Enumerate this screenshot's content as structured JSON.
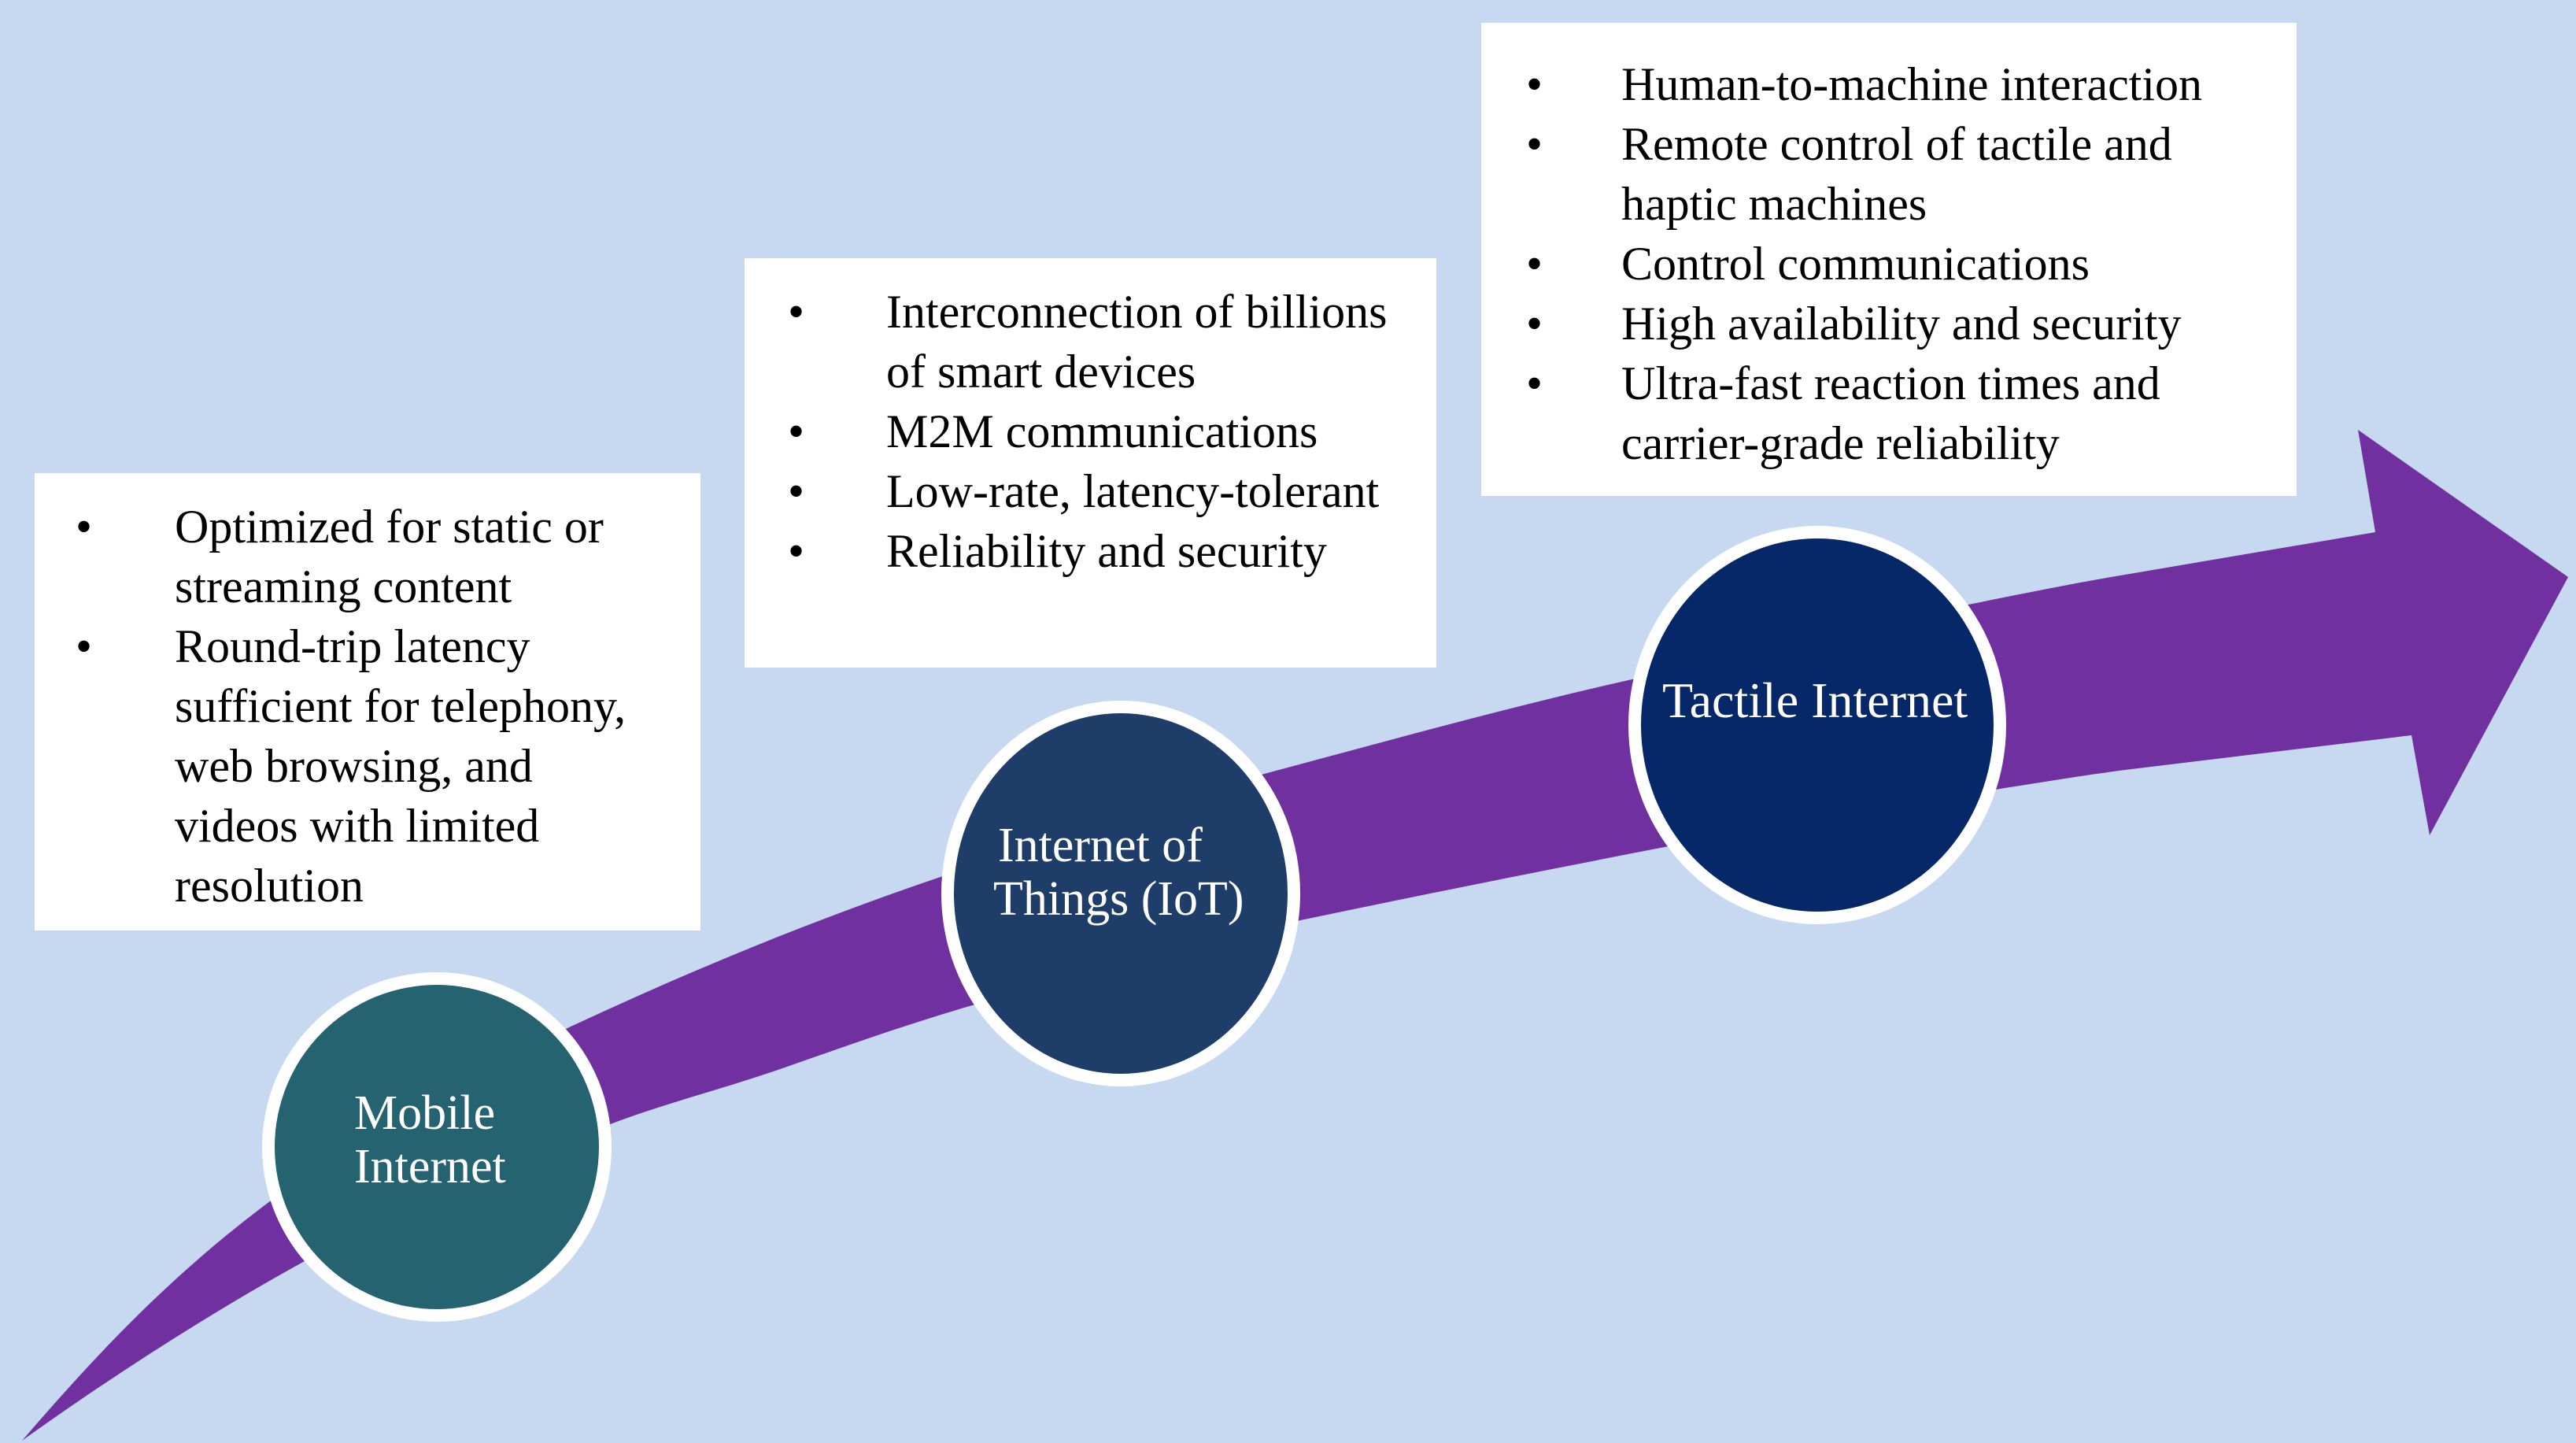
{
  "diagram": {
    "type": "evolution-timeline",
    "colors": {
      "background": "#C6D9F0",
      "arrow": "#7030A0",
      "mobile_node": "#256370",
      "iot_node": "#1E3D68",
      "tactile_node": "#062868",
      "node_ring": "#FFFFFF",
      "box_fill": "#FFFFFF",
      "text": "#000000",
      "node_text": "#FFFFFF"
    },
    "stages": [
      {
        "id": "mobile",
        "label_lines": [
          "Mobile",
          "Internet"
        ],
        "bullet_char": "•",
        "bullets": [
          {
            "lines": [
              "Optimized for static or",
              "streaming content"
            ]
          },
          {
            "lines": [
              "Round-trip latency",
              "sufficient for telephony,",
              "web browsing, and",
              "videos with limited",
              "resolution"
            ]
          }
        ]
      },
      {
        "id": "iot",
        "label_lines": [
          "Internet of",
          "Things (IoT)"
        ],
        "bullet_char": "•",
        "bullets": [
          {
            "lines": [
              "Interconnection of billions",
              "of smart devices"
            ]
          },
          {
            "lines": [
              "M2M communications"
            ]
          },
          {
            "lines": [
              "Low-rate, latency-tolerant"
            ]
          },
          {
            "lines": [
              "Reliability and security"
            ]
          }
        ]
      },
      {
        "id": "tactile",
        "label_lines": [
          "Tactile Internet"
        ],
        "bullet_char": "•",
        "bullets": [
          {
            "lines": [
              "Human-to-machine interaction"
            ]
          },
          {
            "lines": [
              "Remote control of tactile and",
              "haptic machines"
            ]
          },
          {
            "lines": [
              "Control communications"
            ]
          },
          {
            "lines": [
              "High availability and security"
            ]
          },
          {
            "lines": [
              "Ultra-fast reaction times and",
              "carrier-grade reliability"
            ]
          }
        ]
      }
    ]
  }
}
